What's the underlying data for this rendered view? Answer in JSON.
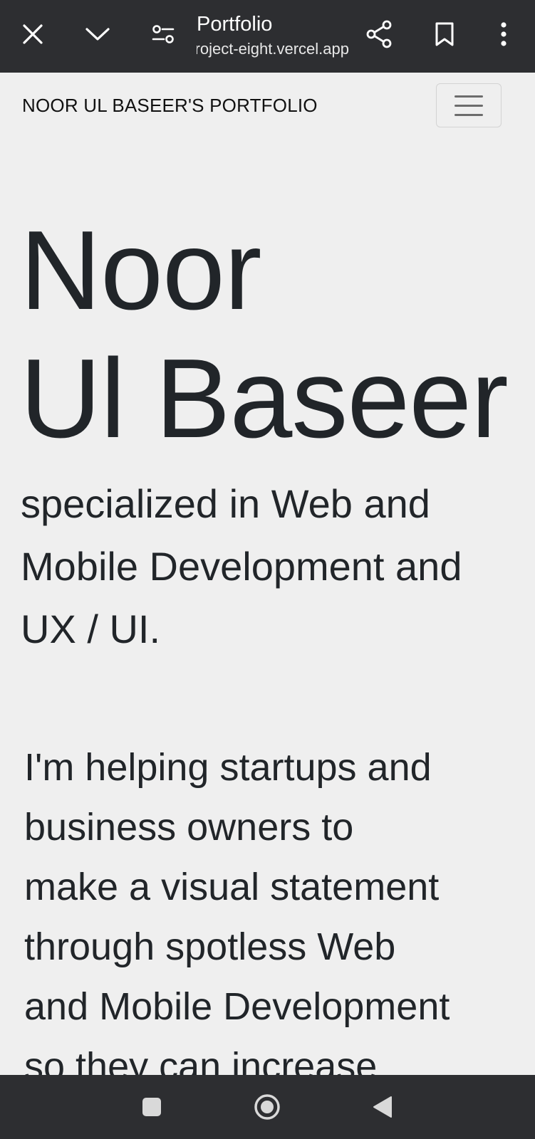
{
  "browser": {
    "tab_title": "Portfolio",
    "url": "project-eight.vercel.app",
    "icons": {
      "close": "close-icon",
      "minimize": "chevron-down-icon",
      "site_settings": "tune-icon",
      "share": "share-icon",
      "bookmark": "bookmark-icon",
      "menu": "more-vert-icon"
    }
  },
  "navbar": {
    "brand": "NOOR UL BASEER'S PORTFOLIO",
    "toggler_icon": "hamburger-menu-icon"
  },
  "hero": {
    "first_name": "Noor",
    "last_name": "Ul Baseer",
    "specialty": "specialized in Web and Mobile Development and UX / UI.",
    "pitch_lines": [
      "I'm helping startups and",
      "business owners to",
      "make a visual statement",
      "through spotless Web",
      "and Mobile Development",
      "so they can increase"
    ]
  },
  "system_nav": {
    "recents": "square-recents-icon",
    "home": "circle-home-icon",
    "back": "triangle-back-icon"
  },
  "colors": {
    "browser_bar": "#2d2e31",
    "page_background": "#efefef",
    "text": "#212529"
  }
}
